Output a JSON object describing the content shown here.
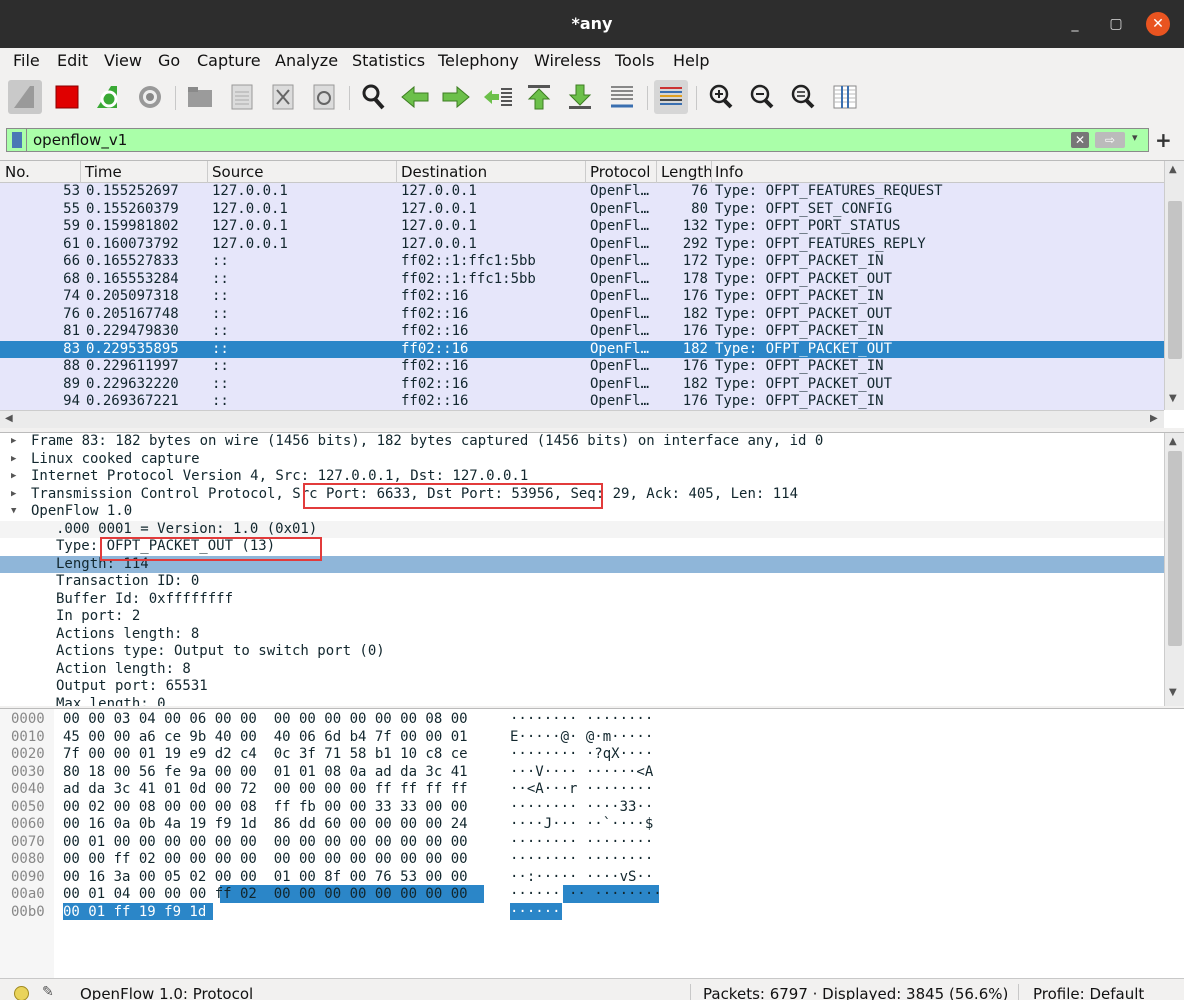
{
  "window": {
    "title": "*any"
  },
  "menu": [
    "File",
    "Edit",
    "View",
    "Go",
    "Capture",
    "Analyze",
    "Statistics",
    "Telephony",
    "Wireless",
    "Tools",
    "Help"
  ],
  "filter": {
    "value": "openflow_v1"
  },
  "columns": {
    "no": "No.",
    "time": "Time",
    "source": "Source",
    "destination": "Destination",
    "protocol": "Protocol",
    "length": "Length",
    "info": "Info"
  },
  "packets": [
    {
      "no": "53",
      "time": "0.155252697",
      "src": "127.0.0.1",
      "dst": "127.0.0.1",
      "proto": "OpenFl…",
      "len": "76",
      "info": "Type: OFPT_FEATURES_REQUEST"
    },
    {
      "no": "55",
      "time": "0.155260379",
      "src": "127.0.0.1",
      "dst": "127.0.0.1",
      "proto": "OpenFl…",
      "len": "80",
      "info": "Type: OFPT_SET_CONFIG"
    },
    {
      "no": "59",
      "time": "0.159981802",
      "src": "127.0.0.1",
      "dst": "127.0.0.1",
      "proto": "OpenFl…",
      "len": "132",
      "info": "Type: OFPT_PORT_STATUS"
    },
    {
      "no": "61",
      "time": "0.160073792",
      "src": "127.0.0.1",
      "dst": "127.0.0.1",
      "proto": "OpenFl…",
      "len": "292",
      "info": "Type: OFPT_FEATURES_REPLY"
    },
    {
      "no": "66",
      "time": "0.165527833",
      "src": "::",
      "dst": "ff02::1:ffc1:5bb",
      "proto": "OpenFl…",
      "len": "172",
      "info": "Type: OFPT_PACKET_IN"
    },
    {
      "no": "68",
      "time": "0.165553284",
      "src": "::",
      "dst": "ff02::1:ffc1:5bb",
      "proto": "OpenFl…",
      "len": "178",
      "info": "Type: OFPT_PACKET_OUT"
    },
    {
      "no": "74",
      "time": "0.205097318",
      "src": "::",
      "dst": "ff02::16",
      "proto": "OpenFl…",
      "len": "176",
      "info": "Type: OFPT_PACKET_IN"
    },
    {
      "no": "76",
      "time": "0.205167748",
      "src": "::",
      "dst": "ff02::16",
      "proto": "OpenFl…",
      "len": "182",
      "info": "Type: OFPT_PACKET_OUT"
    },
    {
      "no": "81",
      "time": "0.229479830",
      "src": "::",
      "dst": "ff02::16",
      "proto": "OpenFl…",
      "len": "176",
      "info": "Type: OFPT_PACKET_IN"
    },
    {
      "no": "83",
      "time": "0.229535895",
      "src": "::",
      "dst": "ff02::16",
      "proto": "OpenFl…",
      "len": "182",
      "info": "Type: OFPT_PACKET_OUT"
    },
    {
      "no": "88",
      "time": "0.229611997",
      "src": "::",
      "dst": "ff02::16",
      "proto": "OpenFl…",
      "len": "176",
      "info": "Type: OFPT_PACKET_IN"
    },
    {
      "no": "89",
      "time": "0.229632220",
      "src": "::",
      "dst": "ff02::16",
      "proto": "OpenFl…",
      "len": "182",
      "info": "Type: OFPT_PACKET_OUT"
    },
    {
      "no": "94",
      "time": "0.269367221",
      "src": "::",
      "dst": "ff02::16",
      "proto": "OpenFl…",
      "len": "176",
      "info": "Type: OFPT_PACKET_IN"
    }
  ],
  "details": [
    "Frame 83: 182 bytes on wire (1456 bits), 182 bytes captured (1456 bits) on interface any, id 0",
    "Linux cooked capture",
    "Internet Protocol Version 4, Src: 127.0.0.1, Dst: 127.0.0.1",
    "Transmission Control Protocol, Src Port: 6633, Dst Port: 53956, Seq: 29, Ack: 405, Len: 114",
    "OpenFlow 1.0",
    ".000 0001 = Version: 1.0 (0x01)",
    "Type: OFPT_PACKET_OUT (13)",
    "Length: 114",
    "Transaction ID: 0",
    "Buffer Id: 0xffffffff",
    "In port: 2",
    "Actions length: 8",
    "Actions type: Output to switch port (0)",
    "Action length: 8",
    "Output port: 65531",
    "Max length: 0"
  ],
  "hex": [
    {
      "off": "0000",
      "bytes": "00 00 03 04 00 06 00 00  00 00 00 00 00 00 08 00",
      "ascii": "········ ········"
    },
    {
      "off": "0010",
      "bytes": "45 00 00 a6 ce 9b 40 00  40 06 6d b4 7f 00 00 01",
      "ascii": "E·····@· @·m·····"
    },
    {
      "off": "0020",
      "bytes": "7f 00 00 01 19 e9 d2 c4  0c 3f 71 58 b1 10 c8 ce",
      "ascii": "········ ·?qX····"
    },
    {
      "off": "0030",
      "bytes": "80 18 00 56 fe 9a 00 00  01 01 08 0a ad da 3c 41",
      "ascii": "···V···· ······<A"
    },
    {
      "off": "0040",
      "bytes": "ad da 3c 41 01 0d 00 72  00 00 00 00 ff ff ff ff",
      "ascii": "··<A···r ········"
    },
    {
      "off": "0050",
      "bytes": "00 02 00 08 00 00 00 08  ff fb 00 00 33 33 00 00",
      "ascii": "········ ····33··"
    },
    {
      "off": "0060",
      "bytes": "00 16 0a 0b 4a 19 f9 1d  86 dd 60 00 00 00 00 24",
      "ascii": "····J··· ··`····$"
    },
    {
      "off": "0070",
      "bytes": "00 01 00 00 00 00 00 00  00 00 00 00 00 00 00 00",
      "ascii": "········ ········"
    },
    {
      "off": "0080",
      "bytes": "00 00 ff 02 00 00 00 00  00 00 00 00 00 00 00 00",
      "ascii": "········ ········"
    },
    {
      "off": "0090",
      "bytes": "00 16 3a 00 05 02 00 00  01 00 8f 00 76 53 00 00",
      "ascii": "··:····· ····vS··"
    },
    {
      "off": "00a0",
      "bytes": "00 01 04 00 00 00 ff 02  00 00 00 00 00 00 00 00",
      "ascii": "······ ·· ········"
    },
    {
      "off": "00b0",
      "bytes": "00 01 ff 19 f9 1d",
      "ascii": "······"
    }
  ],
  "status": {
    "left": "OpenFlow 1.0: Protocol",
    "packets": "Packets: 6797 · Displayed: 3845 (56.6%)",
    "profile": "Profile: Default"
  }
}
